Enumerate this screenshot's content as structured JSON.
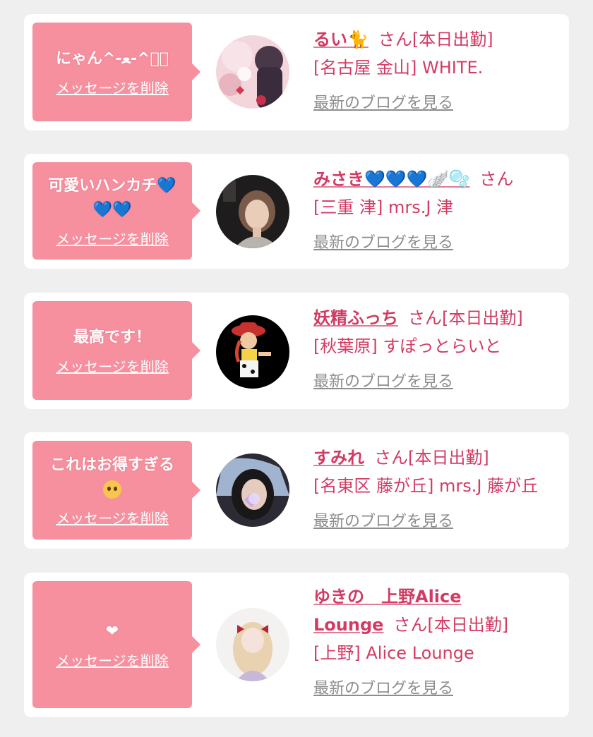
{
  "delete_label": "メッセージを削除",
  "blog_label": "最新のブログを見る",
  "colors": {
    "background": "#efefef",
    "card": "#ffffff",
    "bubble": "#f6909f",
    "accent": "#d23b63",
    "muted": "#8d8d8d"
  },
  "items": [
    {
      "message": "にゃん^-ﻌ-^ฅ゙",
      "name": "るい🐈",
      "suffix": "さん[本日出勤]",
      "shop": "[名古屋 金山] WHITE.",
      "avatar": "avatar-pink-floral"
    },
    {
      "message": "可愛いハンカチ💙💙💙",
      "name": "みさき💙💙💙🪽🫧",
      "suffix": "さん",
      "shop": "[三重 津] mrs.J 津",
      "avatar": "avatar-woman-dark"
    },
    {
      "message": "最高です！",
      "name": "妖精ふっち",
      "suffix": "さん[本日出勤]",
      "shop": "[秋葉原] すぽっとらいと",
      "avatar": "avatar-cowgirl-toy"
    },
    {
      "message": "これはお得すぎる",
      "message_emoji": "pleading-face-icon",
      "name": "すみれ",
      "suffix": "さん[本日出勤]",
      "shop": "[名東区 藤が丘] mrs.J 藤が丘",
      "avatar": "avatar-woman-heart-sticker"
    },
    {
      "message": "❤",
      "name": "ゆきの　上野Alice Lounge",
      "suffix": "さん[本日出勤]",
      "shop": "[上野] Alice Lounge",
      "avatar": "avatar-blonde-doll"
    }
  ]
}
